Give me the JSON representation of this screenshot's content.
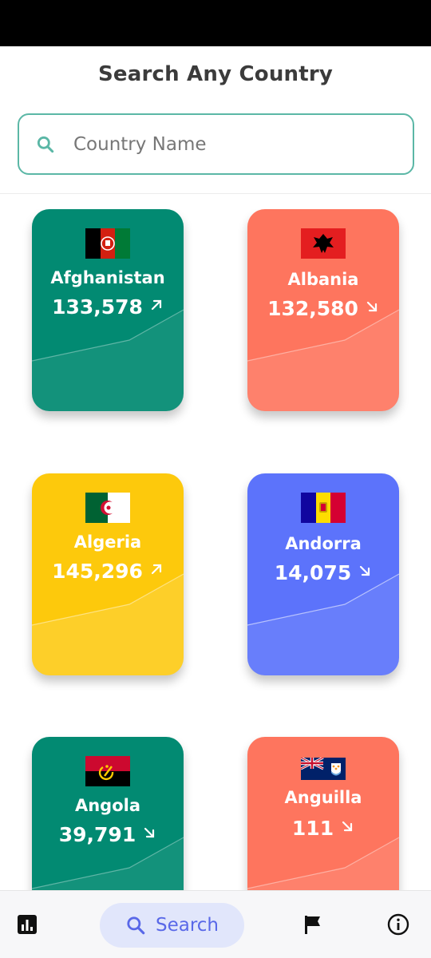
{
  "header": {
    "title": "Search Any Country"
  },
  "search": {
    "placeholder": "Country Name",
    "value": "",
    "icon": "search-icon"
  },
  "colors": {
    "green": "#028a72",
    "coral": "#fe755e",
    "yellow": "#fdc90c",
    "blue": "#5c73fb",
    "accent": "#5bb7a6"
  },
  "countries": [
    {
      "name": "Afghanistan",
      "value": "133,578",
      "trend": "up",
      "color": "#028a72",
      "flag": "flag-afghanistan-icon"
    },
    {
      "name": "Albania",
      "value": "132,580",
      "trend": "down",
      "color": "#fe755e",
      "flag": "flag-albania-icon"
    },
    {
      "name": "Algeria",
      "value": "145,296",
      "trend": "up",
      "color": "#fdc90c",
      "flag": "flag-algeria-icon"
    },
    {
      "name": "Andorra",
      "value": "14,075",
      "trend": "down",
      "color": "#5c73fb",
      "flag": "flag-andorra-icon"
    },
    {
      "name": "Angola",
      "value": "39,791",
      "trend": "down",
      "color": "#028a72",
      "flag": "flag-angola-icon"
    },
    {
      "name": "Anguilla",
      "value": "111",
      "trend": "down",
      "color": "#fe755e",
      "flag": "flag-anguilla-icon"
    }
  ],
  "nav": {
    "stats_icon": "bar-chart-icon",
    "search_label": "Search",
    "flag_icon": "flag-icon",
    "info_icon": "info-icon"
  }
}
